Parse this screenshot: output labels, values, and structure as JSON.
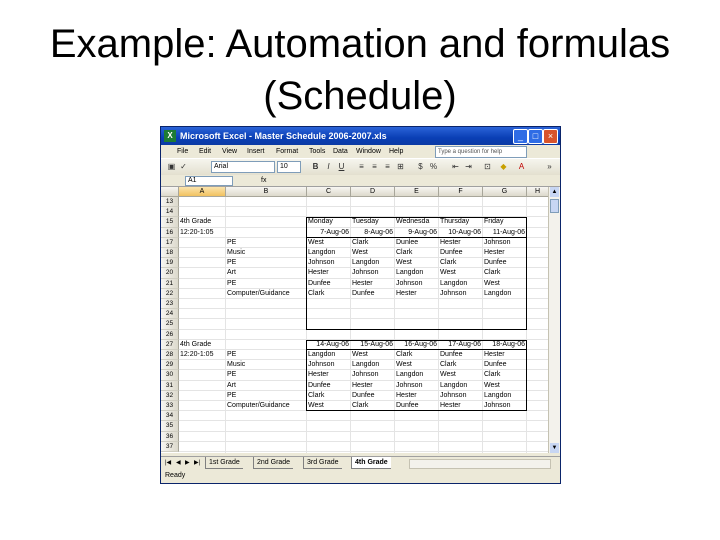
{
  "slide": {
    "title_line1": "Example: Automation and formulas",
    "title_line2": "(Schedule)"
  },
  "window": {
    "title": "Microsoft Excel - Master Schedule 2006-2007.xls",
    "buttons": {
      "minimize": "_",
      "maximize": "□",
      "close": "×"
    }
  },
  "menus": [
    "File",
    "Edit",
    "View",
    "Insert",
    "Format",
    "Tools",
    "Data",
    "Window",
    "Help"
  ],
  "help_placeholder": "Type a question for help",
  "toolbar": {
    "font_name": "Arial",
    "font_size": "10"
  },
  "formula_bar": {
    "name_box": "A1",
    "fx": "fx"
  },
  "columns": [
    "A",
    "B",
    "C",
    "D",
    "E",
    "F",
    "G",
    "H"
  ],
  "rows": [
    {
      "n": "13",
      "c": [
        "",
        "",
        "",
        "",
        "",
        "",
        ""
      ]
    },
    {
      "n": "14",
      "c": [
        "",
        "",
        "",
        "",
        "",
        "",
        ""
      ]
    },
    {
      "n": "15",
      "c": [
        "4th Grade",
        "",
        "Monday",
        "Tuesday",
        "Wednesda",
        "Thursday",
        "Friday"
      ]
    },
    {
      "n": "16",
      "c": [
        "12:20-1:05",
        "",
        "7-Aug-06",
        "8-Aug-06",
        "9-Aug-06",
        "10-Aug-06",
        "11-Aug-06"
      ]
    },
    {
      "n": "17",
      "c": [
        "",
        "PE",
        "West",
        "Clark",
        "Dunlee",
        "Hester",
        "Johnson"
      ]
    },
    {
      "n": "18",
      "c": [
        "",
        "Music",
        "Langdon",
        "West",
        "Clark",
        "Dunfee",
        "Hester"
      ]
    },
    {
      "n": "19",
      "c": [
        "",
        "PE",
        "Johnson",
        "Langdon",
        "West",
        "Clark",
        "Dunfee"
      ]
    },
    {
      "n": "20",
      "c": [
        "",
        "Art",
        "Hester",
        "Johnson",
        "Langdon",
        "West",
        "Clark"
      ]
    },
    {
      "n": "21",
      "c": [
        "",
        "PE",
        "Dunfee",
        "Hester",
        "Johnson",
        "Langdon",
        "West"
      ]
    },
    {
      "n": "22",
      "c": [
        "",
        "Computer/Guidance",
        "Clark",
        "Dunfee",
        "Hester",
        "Johnson",
        "Langdon"
      ]
    },
    {
      "n": "23",
      "c": [
        "",
        "",
        "",
        "",
        "",
        "",
        ""
      ]
    },
    {
      "n": "24",
      "c": [
        "",
        "",
        "",
        "",
        "",
        "",
        ""
      ]
    },
    {
      "n": "25",
      "c": [
        "",
        "",
        "",
        "",
        "",
        "",
        ""
      ]
    },
    {
      "n": "26",
      "c": [
        "",
        "",
        "",
        "",
        "",
        "",
        ""
      ]
    },
    {
      "n": "27",
      "c": [
        "4th Grade",
        "",
        "14-Aug-06",
        "15-Aug-06",
        "16-Aug-06",
        "17-Aug-06",
        "18-Aug-06"
      ]
    },
    {
      "n": "28",
      "c": [
        "12:20-1:05",
        "PE",
        "Langdon",
        "West",
        "Clark",
        "Dunfee",
        "Hester"
      ]
    },
    {
      "n": "29",
      "c": [
        "",
        "Music",
        "Johnson",
        "Langdon",
        "West",
        "Clark",
        "Dunfee"
      ]
    },
    {
      "n": "30",
      "c": [
        "",
        "PE",
        "Hester",
        "Johnson",
        "Langdon",
        "West",
        "Clark"
      ]
    },
    {
      "n": "31",
      "c": [
        "",
        "Art",
        "Dunfee",
        "Hester",
        "Johnson",
        "Langdon",
        "West"
      ]
    },
    {
      "n": "32",
      "c": [
        "",
        "PE",
        "Clark",
        "Dunfee",
        "Hester",
        "Johnson",
        "Langdon"
      ]
    },
    {
      "n": "33",
      "c": [
        "",
        "Computer/Guidance",
        "West",
        "Clark",
        "Dunfee",
        "Hester",
        "Johnson"
      ]
    },
    {
      "n": "34",
      "c": [
        "",
        "",
        "",
        "",
        "",
        "",
        ""
      ]
    },
    {
      "n": "35",
      "c": [
        "",
        "",
        "",
        "",
        "",
        "",
        ""
      ]
    },
    {
      "n": "36",
      "c": [
        "",
        "",
        "",
        "",
        "",
        "",
        ""
      ]
    },
    {
      "n": "37",
      "c": [
        "",
        "",
        "",
        "",
        "",
        "",
        ""
      ]
    }
  ],
  "sheet_tabs": [
    "1st Grade",
    "2nd Grade",
    "3rd Grade",
    "4th Grade"
  ],
  "status": "Ready"
}
